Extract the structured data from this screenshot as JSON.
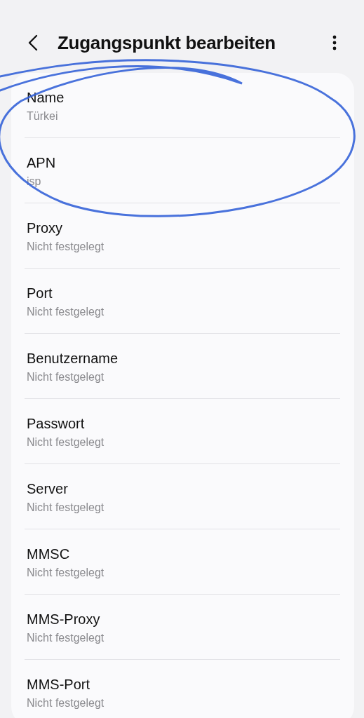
{
  "header": {
    "title": "Zugangspunkt bearbeiten"
  },
  "fields": [
    {
      "label": "Name",
      "value": "Türkei"
    },
    {
      "label": "APN",
      "value": "isp"
    },
    {
      "label": "Proxy",
      "value": "Nicht festgelegt"
    },
    {
      "label": "Port",
      "value": "Nicht festgelegt"
    },
    {
      "label": "Benutzername",
      "value": "Nicht festgelegt"
    },
    {
      "label": "Passwort",
      "value": "Nicht festgelegt"
    },
    {
      "label": "Server",
      "value": "Nicht festgelegt"
    },
    {
      "label": "MMSC",
      "value": "Nicht festgelegt"
    },
    {
      "label": "MMS-Proxy",
      "value": "Nicht festgelegt"
    },
    {
      "label": "MMS-Port",
      "value": "Nicht festgelegt"
    }
  ]
}
